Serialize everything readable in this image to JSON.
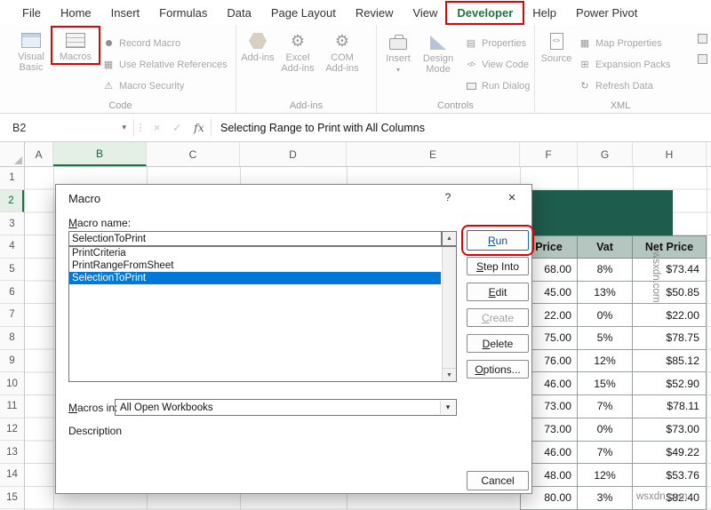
{
  "icons": {
    "dropdown_caret": "▾",
    "close": "×",
    "check": "✓",
    "fx": "fx",
    "dots": "⋮",
    "up_arrow": "▲",
    "down_arrow": "▼",
    "help": "?",
    "gear": "⚙",
    "warning": "⚠",
    "refresh": "↻",
    "grid": "▦",
    "window": "▤",
    "plus_box": "⊞",
    "code": "</>"
  },
  "ribbon": {
    "tabs": [
      "File",
      "Home",
      "Insert",
      "Formulas",
      "Data",
      "Page Layout",
      "Review",
      "View",
      "Developer",
      "Help",
      "Power Pivot"
    ],
    "active_tab": "Developer",
    "code_group": {
      "label": "Code",
      "visual_basic": "Visual Basic",
      "macros": "Macros",
      "record_macro": "Record Macro",
      "use_relative_references": "Use Relative References",
      "macro_security": "Macro Security"
    },
    "addins_group": {
      "label": "Add-ins",
      "addins": "Add-ins",
      "excel_addins": "Excel Add-ins",
      "com_addins": "COM Add-ins"
    },
    "controls_group": {
      "label": "Controls",
      "insert": "Insert",
      "design_mode": "Design Mode",
      "properties": "Properties",
      "view_code": "View Code",
      "run_dialog": "Run Dialog"
    },
    "xml_group": {
      "label": "XML",
      "source": "Source",
      "map_properties": "Map Properties",
      "expansion_packs": "Expansion Packs",
      "refresh_data": "Refresh Data"
    }
  },
  "formula_bar": {
    "name_box": "B2",
    "formula": "Selecting Range to Print with All Columns"
  },
  "grid": {
    "col_headers": [
      "A",
      "B",
      "C",
      "D",
      "E",
      "F",
      "G",
      "H"
    ],
    "row_headers": [
      "1",
      "2",
      "3",
      "4",
      "5",
      "6",
      "7",
      "8",
      "9",
      "10",
      "11",
      "12",
      "13",
      "14",
      "15"
    ],
    "selected_cell": "B2"
  },
  "sheet_table": {
    "headers": [
      "Price",
      "Vat",
      "Net Price"
    ],
    "rows": [
      [
        "68.00",
        "8%",
        "$73.44"
      ],
      [
        "45.00",
        "13%",
        "$50.85"
      ],
      [
        "22.00",
        "0%",
        "$22.00"
      ],
      [
        "75.00",
        "5%",
        "$78.75"
      ],
      [
        "76.00",
        "12%",
        "$85.12"
      ],
      [
        "46.00",
        "15%",
        "$52.90"
      ],
      [
        "73.00",
        "7%",
        "$78.11"
      ],
      [
        "73.00",
        "0%",
        "$73.00"
      ],
      [
        "46.00",
        "7%",
        "$49.22"
      ],
      [
        "48.00",
        "12%",
        "$53.76"
      ],
      [
        "80.00",
        "3%",
        "$82.40"
      ]
    ]
  },
  "dialog": {
    "title": "Macro",
    "macro_name_label": "Macro name:",
    "macro_name_value": "SelectionToPrint",
    "list_items": [
      "PrintCriteria",
      "PrintRangeFromSheet",
      "SelectionToPrint"
    ],
    "selected_item": "SelectionToPrint",
    "run": "Run",
    "step_into": "Step Into",
    "edit": "Edit",
    "create": "Create",
    "delete": "Delete",
    "options": "Options...",
    "cancel": "Cancel",
    "macros_in_label": "Macros in:",
    "macros_in_value": "All Open Workbooks",
    "description_label": "Description"
  },
  "watermark": {
    "vertical": "wsxdn.com",
    "bottom": "wsxdn.com"
  },
  "colors": {
    "accent_green": "#217346",
    "annotation_red": "#E30000",
    "selection_blue": "#0078D7",
    "table_title_bg": "#1E5C4E",
    "table_header_bg": "#B5C6C0"
  }
}
